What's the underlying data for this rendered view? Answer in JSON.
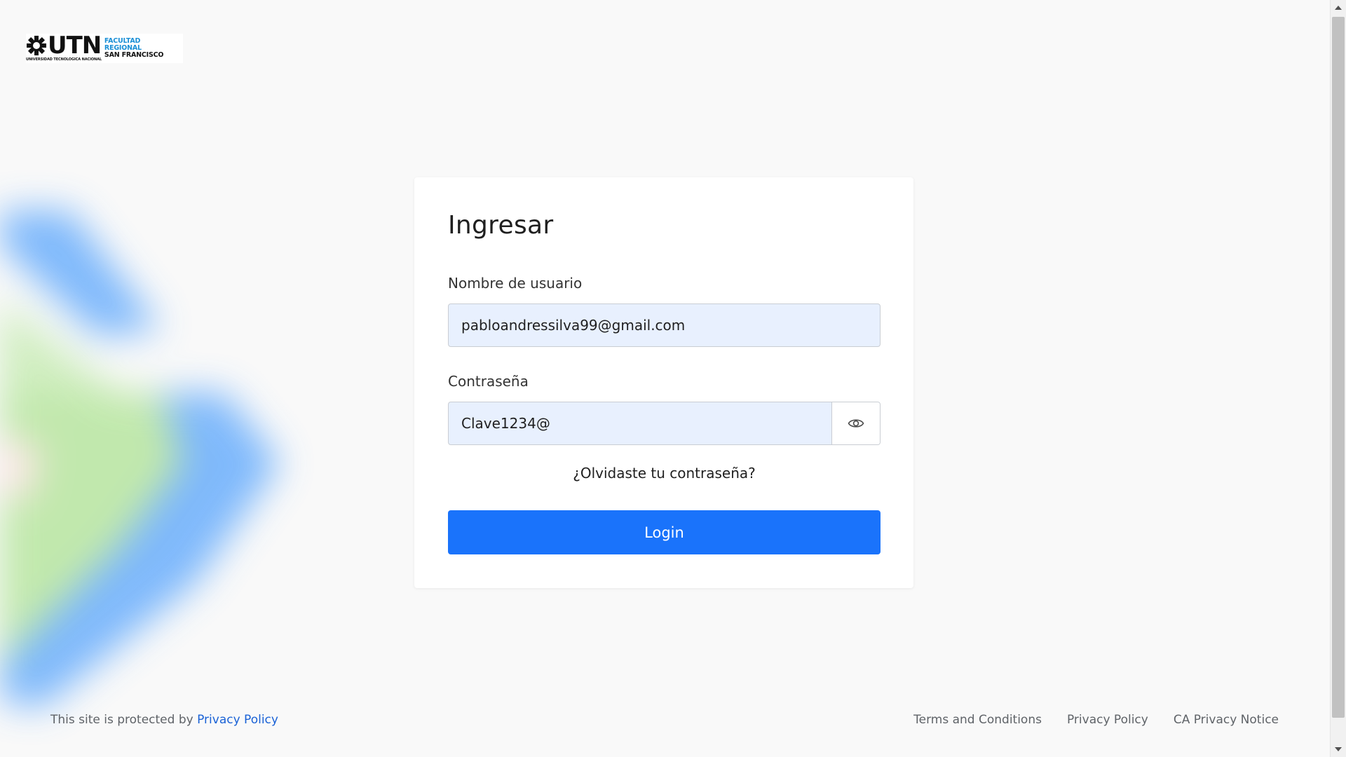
{
  "brand": {
    "logo_main": "UTN",
    "logo_sub": "UNIVERSIDAD TECNOLOGICA NACIONAL",
    "logo_line1": "FACULTAD",
    "logo_line2": "REGIONAL",
    "logo_line3": "SAN FRANCISCO",
    "logo_icon": "utn-emblem-icon"
  },
  "login": {
    "title": "Ingresar",
    "username_label": "Nombre de usuario",
    "username_value": "pabloandressilva99@gmail.com",
    "password_label": "Contraseña",
    "password_value": "Clave1234@",
    "show_password_icon": "eye-icon",
    "forgot_link": "¿Olvidaste tu contraseña?",
    "submit_label": "Login"
  },
  "footer": {
    "protected_text": "This site is protected by",
    "protected_link": "Privacy Policy",
    "links": [
      "Terms and Conditions",
      "Privacy Policy",
      "CA Privacy Notice"
    ]
  },
  "colors": {
    "primary": "#1a73fb",
    "input_bg": "#e8f0fe",
    "page_bg": "#f9f9f9",
    "deco_blue": "#6aaefc",
    "deco_green": "#b8e6a0"
  }
}
